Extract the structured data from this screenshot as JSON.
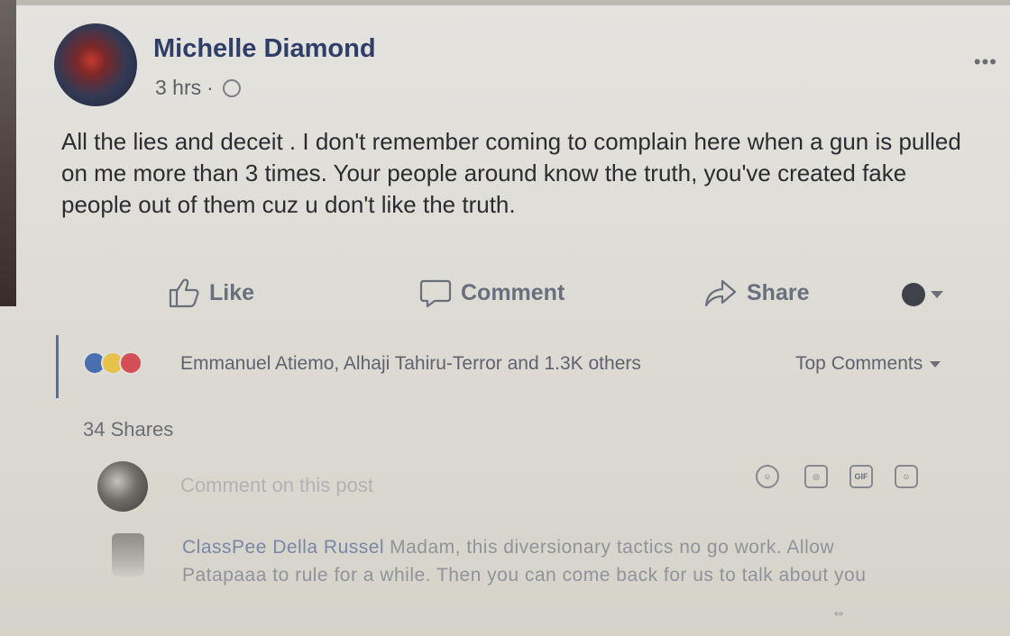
{
  "post": {
    "author": "Michelle Diamond",
    "time": "3 hrs",
    "separator": "·",
    "privacy_icon": "globe-icon",
    "more_icon": "more-options-icon",
    "body": "All the lies and deceit . I don't remember coming to complain here when a gun is pulled on me more than 3 times. Your people around know the truth, you've created fake people out of them cuz u don't like the truth."
  },
  "actions": {
    "like_label": "Like",
    "comment_label": "Comment",
    "share_label": "Share"
  },
  "reactions": {
    "icons": [
      "like-reaction-icon",
      "haha-reaction-icon",
      "love-reaction-icon"
    ],
    "names": "Emmanuel Atiemo, Alhaji Tahiru-Terror and 1.3K others",
    "sort_label": "Top Comments"
  },
  "shares": {
    "label": "34 Shares"
  },
  "composer": {
    "placeholder": "Comment on this post",
    "tools": [
      "emoji-icon",
      "camera-icon",
      "gif-icon",
      "sticker-icon"
    ],
    "gif_label": "GIF"
  },
  "comment": {
    "author": "ClassPee Della Russel",
    "text": "Madam, this diversionary tactics no go work. Allow Patapaaa to rule for a while. Then you can come back for us to talk about you"
  },
  "colors": {
    "author_name": "#2f3e69",
    "like_reaction": "#4a6fb0",
    "love_reaction": "#d44e58",
    "haha_reaction": "#e6c24a"
  }
}
